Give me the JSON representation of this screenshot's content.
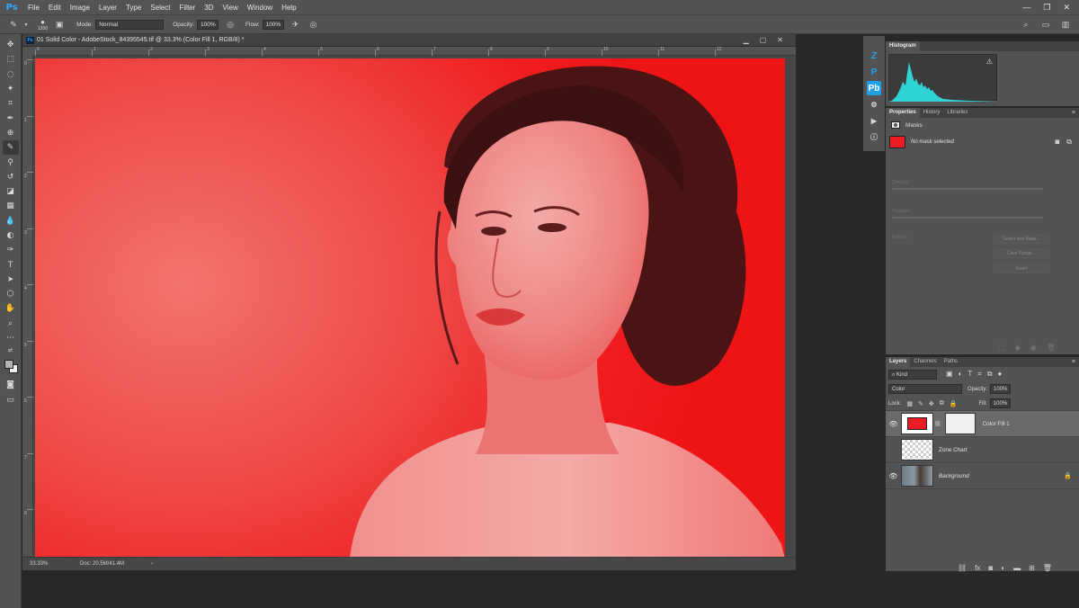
{
  "menu": {
    "logo": "Ps",
    "items": [
      "File",
      "Edit",
      "Image",
      "Layer",
      "Type",
      "Select",
      "Filter",
      "3D",
      "View",
      "Window",
      "Help"
    ]
  },
  "options": {
    "brush_size": "1200",
    "mode_label": "Mode:",
    "mode_value": "Normal",
    "opacity_label": "Opacity:",
    "opacity_value": "100%",
    "flow_label": "Flow:",
    "flow_value": "100%"
  },
  "document": {
    "title": "01 Solid Color - AdobeStock_84395545.tif @ 33.3% (Color Fill 1, RGB/8) *",
    "ruler_h": [
      "0",
      "1",
      "2",
      "3",
      "4",
      "5",
      "6",
      "7",
      "8",
      "9",
      "10",
      "11",
      "12"
    ],
    "ruler_v": [
      "0",
      "1",
      "2",
      "3",
      "4",
      "5",
      "6",
      "7",
      "8"
    ],
    "zoom": "33.33%",
    "doc_size": "Doc: 20.5M/41.4M",
    "canvas_color": "#ee1416"
  },
  "panels": {
    "histogram_tab": "Histogram",
    "properties_tabs": [
      "Properties",
      "History",
      "Libraries"
    ],
    "masks_label": "Masks",
    "no_mask": "No mask selected",
    "density_label": "Density:",
    "feather_label": "Feather:",
    "refine_label": "Refine:",
    "select_mask_btn": "Select and Mask...",
    "color_range_btn": "Color Range...",
    "invert_btn": "Invert",
    "layers_tabs": [
      "Layers",
      "Channels",
      "Paths"
    ],
    "kind_filter": "Kind",
    "blend_mode": "Color",
    "opacity_label": "Opacity:",
    "opacity_value": "100%",
    "lock_label": "Lock:",
    "fill_label": "Fill:",
    "fill_value": "100%",
    "layers": [
      {
        "name": "Color Fill 1",
        "visible": true,
        "selected": true
      },
      {
        "name": "Zone Chart",
        "visible": false,
        "selected": false
      },
      {
        "name": "Background",
        "visible": true,
        "selected": false
      }
    ]
  },
  "colors": {
    "fill_color": "#ed1c24",
    "ps_blue": "#31a8ff",
    "histogram": "#2fd3d3"
  }
}
